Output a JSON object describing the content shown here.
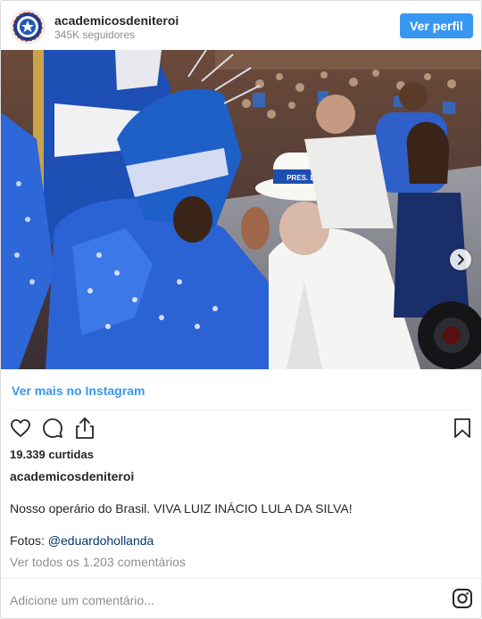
{
  "header": {
    "username": "academicosdeniteroi",
    "followers": "345K seguidores",
    "follow_button": "Ver perfil",
    "avatar_icon": "samba-school-emblem-icon"
  },
  "post": {
    "image_alt": "Desfile de carnaval",
    "hat_band_text": "PRES. LULA",
    "next_icon": "chevron-right-icon"
  },
  "view_more": "Ver mais no Instagram",
  "actions": {
    "like_icon": "heart-icon",
    "comment_icon": "comment-icon",
    "share_icon": "share-icon",
    "save_icon": "bookmark-icon"
  },
  "likes": "19.339 curtidas",
  "caption": {
    "username": "academicosdeniteroi",
    "text": "Nosso operário do Brasil. VIVA LUIZ INÁCIO LULA DA SILVA!",
    "credit_prefix": "Fotos:",
    "credit_handle": "@eduardohollanda"
  },
  "comments_link": "Ver todos os 1.203 comentários",
  "add_comment_placeholder": "Adicione um comentário...",
  "footer_icon": "instagram-logo-icon",
  "colors": {
    "accent": "#3897f0",
    "text": "#262626",
    "muted": "#8e8e8e",
    "costume_blue": "#1f5fc8"
  }
}
